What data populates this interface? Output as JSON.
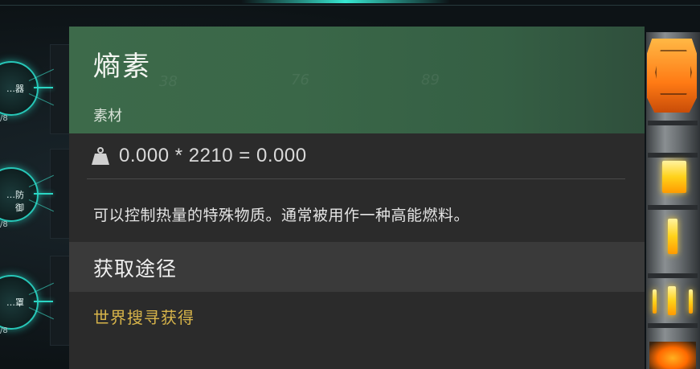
{
  "background_tree": {
    "nodes": [
      {
        "label": "…器",
        "count": "/8"
      },
      {
        "label": "…防御",
        "count": "/8"
      },
      {
        "label": "…罩",
        "count": "/8"
      }
    ],
    "accent_color": "#27c7b8"
  },
  "tooltip": {
    "name": "熵素",
    "type": "素材",
    "watermark_numbers": [
      "38",
      "76",
      "89"
    ],
    "header_color": "#3d6a4a",
    "weight_icon": "weight-icon",
    "stat_text": "0.000 * 2210 = 0.000",
    "description": "可以控制热量的特殊物质。通常被用作一种高能燃料。",
    "source_title": "获取途径",
    "source_items": [
      "世界搜寻获得"
    ],
    "source_item_color": "#d7b44a"
  },
  "decor": {
    "tower_glow_color": "#ffd21a",
    "tower_cap_color": "#ff7a14"
  }
}
